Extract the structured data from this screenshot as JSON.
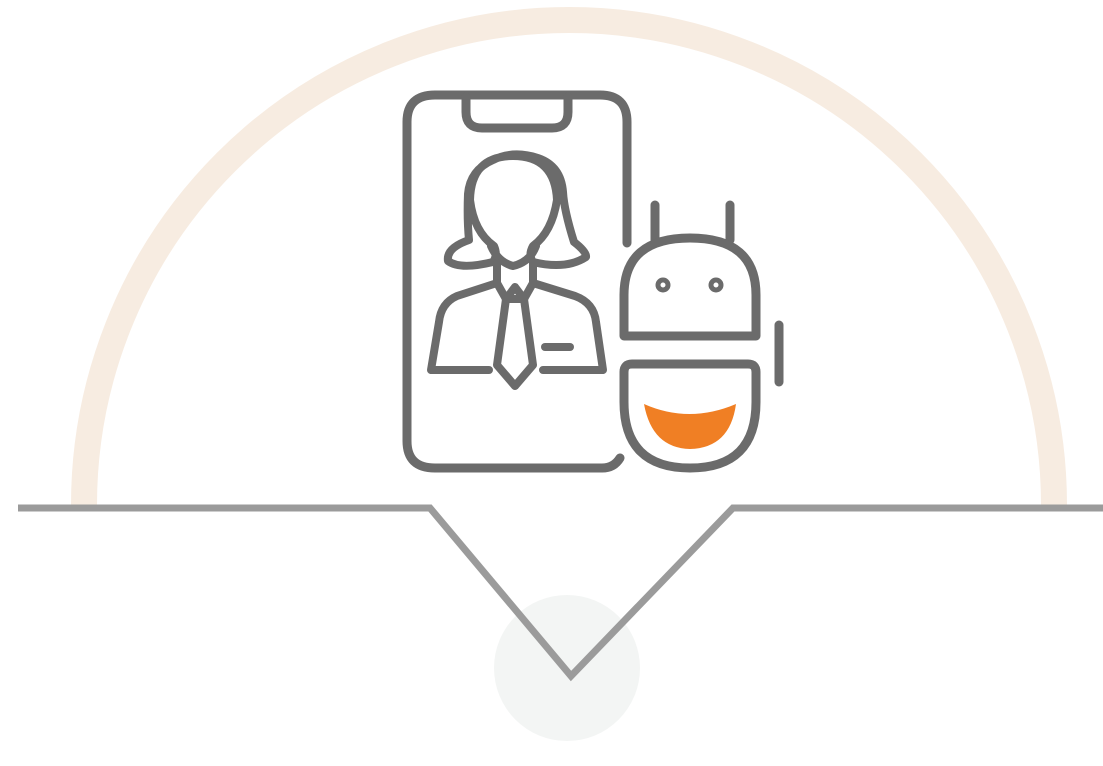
{
  "colors": {
    "background": "#ffffff",
    "arc": "#f7ece1",
    "pointer_line": "#9b9b9b",
    "icon_stroke": "#6b6b6b",
    "robot_mouth": "#f07f24",
    "focus_circle": "#f3f5f4"
  },
  "icons": {
    "main": "phone-with-agent-and-chatbot-icon",
    "phone": "smartphone-icon",
    "agent": "woman-agent-icon",
    "robot": "chatbot-robot-icon"
  }
}
